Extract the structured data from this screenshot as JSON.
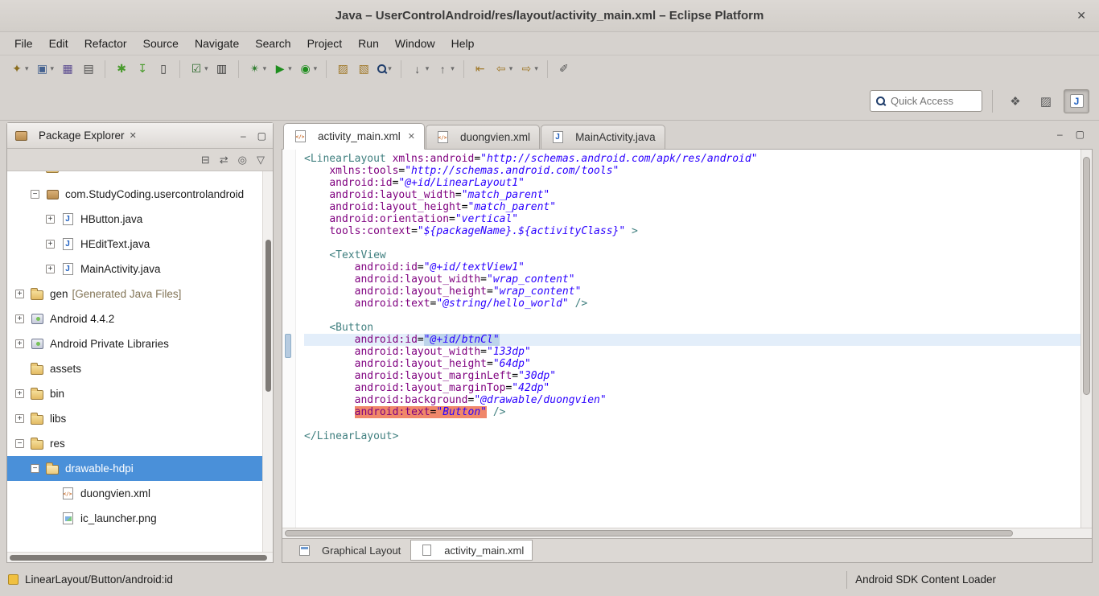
{
  "window": {
    "title": "Java – UserControlAndroid/res/layout/activity_main.xml – Eclipse Platform",
    "close_glyph": "✕"
  },
  "menubar": {
    "items": [
      "File",
      "Edit",
      "Refactor",
      "Source",
      "Navigate",
      "Search",
      "Project",
      "Run",
      "Window",
      "Help"
    ]
  },
  "toolbar": {
    "items": [
      {
        "name": "new-wizard",
        "glyph": "✦",
        "color": "#8a6d1e",
        "dropdown": true
      },
      {
        "name": "new-java-project",
        "glyph": "▣",
        "color": "#44618f",
        "dropdown": true
      },
      {
        "name": "save",
        "glyph": "▦",
        "color": "#5a4a8f"
      },
      {
        "name": "print",
        "glyph": "▤",
        "color": "#4a4a4a"
      },
      {
        "sep": true
      },
      {
        "name": "new-android-application",
        "glyph": "✱",
        "color": "#4a9b2e"
      },
      {
        "name": "android-sdk-manager",
        "glyph": "↧",
        "color": "#4a9b2e"
      },
      {
        "name": "android-virtual-device-manager",
        "glyph": "▯",
        "color": "#3a3a3a"
      },
      {
        "sep": true
      },
      {
        "name": "toggle-breakpoints",
        "glyph": "☑",
        "color": "#2d6a2d",
        "dropdown": true
      },
      {
        "name": "device-monitor",
        "glyph": "▥",
        "color": "#3a3a3a"
      },
      {
        "sep": true
      },
      {
        "name": "debug",
        "glyph": "✴",
        "color": "#2f7d2f",
        "dropdown": true
      },
      {
        "name": "run",
        "glyph": "▶",
        "color": "#1e8e1e",
        "dropdown": true
      },
      {
        "name": "run-external-tools",
        "glyph": "◉",
        "color": "#1e8e1e",
        "dropdown": true
      },
      {
        "sep": true
      },
      {
        "name": "new-task",
        "glyph": "▨",
        "color": "#a07828"
      },
      {
        "name": "open-element",
        "glyph": "▧",
        "color": "#a07828"
      },
      {
        "name": "search",
        "mag": true,
        "color": "#333333",
        "dropdown": true
      },
      {
        "sep": true
      },
      {
        "name": "next-annotation",
        "glyph": "↓",
        "color": "#555555",
        "dropdown": true
      },
      {
        "name": "previous-annotation",
        "glyph": "↑",
        "color": "#555555",
        "dropdown": true
      },
      {
        "sep": true
      },
      {
        "name": "last-edit-location",
        "glyph": "⇤",
        "color": "#a07828"
      },
      {
        "name": "back",
        "glyph": "⇦",
        "color": "#a07828",
        "dropdown": true
      },
      {
        "name": "forward",
        "glyph": "⇨",
        "color": "#a07828",
        "dropdown": true
      },
      {
        "sep": true
      },
      {
        "name": "pin-editor",
        "glyph": "✐",
        "color": "#555555"
      }
    ]
  },
  "quick_access": {
    "placeholder": "Quick Access"
  },
  "perspectives": {
    "buttons": [
      {
        "name": "open-perspective",
        "glyph": "❖"
      },
      {
        "name": "resource-perspective",
        "glyph": "▨"
      },
      {
        "name": "java-perspective",
        "glyph": "J",
        "active": true
      }
    ]
  },
  "package_explorer": {
    "title": "Package Explorer",
    "close_glyph": "✕",
    "win_minimize": "–",
    "win_maximize": "▢",
    "toolbar": [
      {
        "name": "collapse-all",
        "glyph": "⊟"
      },
      {
        "name": "link-with-editor",
        "glyph": "⇄"
      },
      {
        "name": "focus",
        "glyph": "◎"
      },
      {
        "name": "view-menu",
        "glyph": "▽"
      }
    ],
    "tree": [
      {
        "label": "",
        "level": 1,
        "expander": "minus",
        "icon": "folder",
        "partial": true
      },
      {
        "label": "com.StudyCoding.usercontrolandroid",
        "level": 1,
        "expander": "minus",
        "icon": "package"
      },
      {
        "label": "HButton.java",
        "level": 2,
        "expander": "plus",
        "icon": "java"
      },
      {
        "label": "HEditText.java",
        "level": 2,
        "expander": "plus",
        "icon": "java"
      },
      {
        "label": "MainActivity.java",
        "level": 2,
        "expander": "plus",
        "icon": "java"
      },
      {
        "label": "gen",
        "suffix": "[Generated Java Files]",
        "level": 0,
        "expander": "plus",
        "icon": "folder"
      },
      {
        "label": "Android 4.4.2",
        "level": 0,
        "expander": "plus",
        "icon": "library"
      },
      {
        "label": "Android Private Libraries",
        "level": 0,
        "expander": "plus",
        "icon": "library"
      },
      {
        "label": "assets",
        "level": 0,
        "expander": "none",
        "icon": "folder"
      },
      {
        "label": "bin",
        "level": 0,
        "expander": "plus",
        "icon": "folder"
      },
      {
        "label": "libs",
        "level": 0,
        "expander": "plus",
        "icon": "folder"
      },
      {
        "label": "res",
        "level": 0,
        "expander": "minus",
        "icon": "folder"
      },
      {
        "label": "drawable-hdpi",
        "level": 1,
        "expander": "minus",
        "icon": "folder-open",
        "selected": true
      },
      {
        "label": "duongvien.xml",
        "level": 2,
        "expander": "none",
        "icon": "xml"
      },
      {
        "label": "ic_launcher.png",
        "level": 2,
        "expander": "none",
        "icon": "image"
      }
    ]
  },
  "editor": {
    "win_minimize": "–",
    "win_maximize": "▢",
    "tabs": [
      {
        "label": "activity_main.xml",
        "icon": "xml",
        "active": true,
        "close_glyph": "✕"
      },
      {
        "label": "duongvien.xml",
        "icon": "xml"
      },
      {
        "label": "MainActivity.java",
        "icon": "java"
      }
    ],
    "bottom_tabs": [
      {
        "label": "Graphical Layout",
        "icon": "layout"
      },
      {
        "label": "activity_main.xml",
        "icon": "page",
        "active": true
      }
    ],
    "code_lines": [
      {
        "segs": [
          {
            "c": "tag",
            "t": "<LinearLayout"
          },
          {
            "c": "plain",
            "t": " "
          },
          {
            "c": "attr",
            "t": "xmlns:android"
          },
          {
            "c": "plain",
            "t": "="
          },
          {
            "c": "val",
            "t": "\"http://schemas.android.com/apk/res/android\""
          }
        ]
      },
      {
        "segs": [
          {
            "c": "plain",
            "t": "    "
          },
          {
            "c": "attr",
            "t": "xmlns:tools"
          },
          {
            "c": "plain",
            "t": "="
          },
          {
            "c": "val",
            "t": "\"http://schemas.android.com/tools\""
          }
        ]
      },
      {
        "segs": [
          {
            "c": "plain",
            "t": "    "
          },
          {
            "c": "attr",
            "t": "android:id"
          },
          {
            "c": "plain",
            "t": "="
          },
          {
            "c": "val",
            "t": "\"@+id/LinearLayout1\""
          }
        ]
      },
      {
        "segs": [
          {
            "c": "plain",
            "t": "    "
          },
          {
            "c": "attr",
            "t": "android:layout_width"
          },
          {
            "c": "plain",
            "t": "="
          },
          {
            "c": "val",
            "t": "\"match_parent\""
          }
        ]
      },
      {
        "segs": [
          {
            "c": "plain",
            "t": "    "
          },
          {
            "c": "attr",
            "t": "android:layout_height"
          },
          {
            "c": "plain",
            "t": "="
          },
          {
            "c": "val",
            "t": "\"match_parent\""
          }
        ]
      },
      {
        "segs": [
          {
            "c": "plain",
            "t": "    "
          },
          {
            "c": "attr",
            "t": "android:orientation"
          },
          {
            "c": "plain",
            "t": "="
          },
          {
            "c": "val",
            "t": "\"vertical\""
          }
        ]
      },
      {
        "segs": [
          {
            "c": "plain",
            "t": "    "
          },
          {
            "c": "attr",
            "t": "tools:context"
          },
          {
            "c": "plain",
            "t": "="
          },
          {
            "c": "val",
            "t": "\"${packageName}.${activityClass}\""
          },
          {
            "c": "plain",
            "t": " "
          },
          {
            "c": "tag",
            "t": ">"
          }
        ]
      },
      {
        "segs": []
      },
      {
        "segs": [
          {
            "c": "plain",
            "t": "    "
          },
          {
            "c": "tag",
            "t": "<TextView"
          }
        ]
      },
      {
        "segs": [
          {
            "c": "plain",
            "t": "        "
          },
          {
            "c": "attr",
            "t": "android:id"
          },
          {
            "c": "plain",
            "t": "="
          },
          {
            "c": "val",
            "t": "\"@+id/textView1\""
          }
        ]
      },
      {
        "segs": [
          {
            "c": "plain",
            "t": "        "
          },
          {
            "c": "attr",
            "t": "android:layout_width"
          },
          {
            "c": "plain",
            "t": "="
          },
          {
            "c": "val",
            "t": "\"wrap_content\""
          }
        ]
      },
      {
        "segs": [
          {
            "c": "plain",
            "t": "        "
          },
          {
            "c": "attr",
            "t": "android:layout_height"
          },
          {
            "c": "plain",
            "t": "="
          },
          {
            "c": "val",
            "t": "\"wrap_content\""
          }
        ]
      },
      {
        "segs": [
          {
            "c": "plain",
            "t": "        "
          },
          {
            "c": "attr",
            "t": "android:text"
          },
          {
            "c": "plain",
            "t": "="
          },
          {
            "c": "val",
            "t": "\"@string/hello_world\""
          },
          {
            "c": "plain",
            "t": " "
          },
          {
            "c": "tag",
            "t": "/>"
          }
        ]
      },
      {
        "segs": []
      },
      {
        "segs": [
          {
            "c": "plain",
            "t": "    "
          },
          {
            "c": "tag",
            "t": "<Button"
          }
        ]
      },
      {
        "hl": true,
        "segs": [
          {
            "c": "plain",
            "t": "        "
          },
          {
            "c": "attr",
            "t": "android:id"
          },
          {
            "c": "plain",
            "t": "="
          },
          {
            "c": "val",
            "b": "sel",
            "t": "\"@+id/btnCl\""
          }
        ]
      },
      {
        "segs": [
          {
            "c": "plain",
            "t": "        "
          },
          {
            "c": "attr",
            "t": "android:layout_width"
          },
          {
            "c": "plain",
            "t": "="
          },
          {
            "c": "val",
            "t": "\"133dp\""
          }
        ]
      },
      {
        "segs": [
          {
            "c": "plain",
            "t": "        "
          },
          {
            "c": "attr",
            "t": "android:layout_height"
          },
          {
            "c": "plain",
            "t": "="
          },
          {
            "c": "val",
            "t": "\"64dp\""
          }
        ]
      },
      {
        "segs": [
          {
            "c": "plain",
            "t": "        "
          },
          {
            "c": "attr",
            "t": "android:layout_marginLeft"
          },
          {
            "c": "plain",
            "t": "="
          },
          {
            "c": "val",
            "t": "\"30dp\""
          }
        ]
      },
      {
        "segs": [
          {
            "c": "plain",
            "t": "        "
          },
          {
            "c": "attr",
            "t": "android:layout_marginTop"
          },
          {
            "c": "plain",
            "t": "="
          },
          {
            "c": "val",
            "t": "\"42dp\""
          }
        ]
      },
      {
        "segs": [
          {
            "c": "plain",
            "t": "        "
          },
          {
            "c": "attr",
            "t": "android:background"
          },
          {
            "c": "plain",
            "t": "="
          },
          {
            "c": "val",
            "t": "\"@drawable/duongvien\""
          }
        ]
      },
      {
        "segs": [
          {
            "c": "plain",
            "t": "        "
          },
          {
            "c": "attr",
            "b": "occ",
            "t": "android:text"
          },
          {
            "c": "plain",
            "b": "occ",
            "t": "="
          },
          {
            "c": "val",
            "b": "occ",
            "t": "\"Button\""
          },
          {
            "c": "plain",
            "t": " "
          },
          {
            "c": "tag",
            "t": "/>"
          }
        ]
      },
      {
        "segs": []
      },
      {
        "segs": [
          {
            "c": "tag",
            "t": "</LinearLayout>"
          }
        ]
      }
    ]
  },
  "statusbar": {
    "left": "LinearLayout/Button/android:id",
    "right": "Android SDK Content Loader"
  }
}
